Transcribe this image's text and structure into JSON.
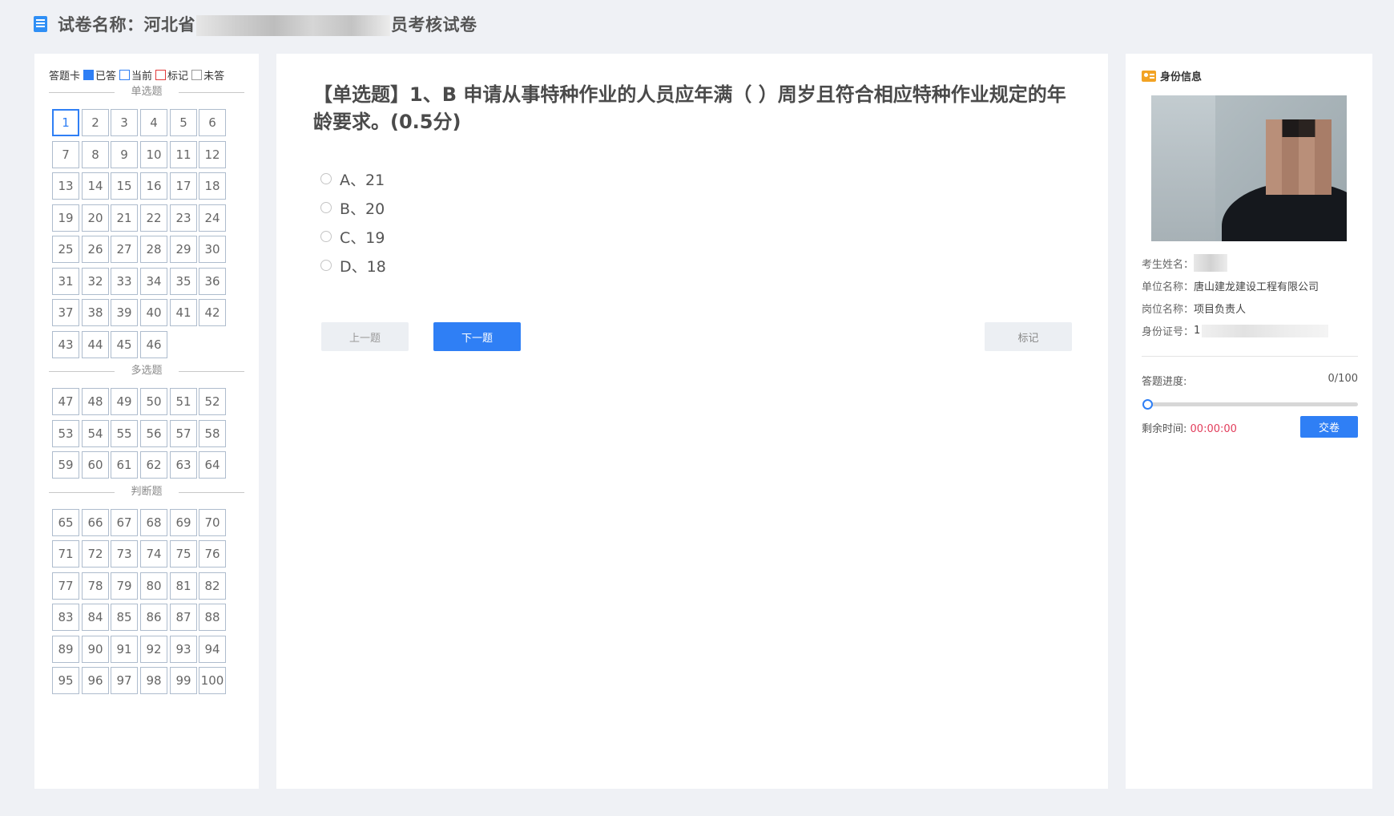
{
  "header": {
    "title_prefix": "试卷名称：河北省",
    "title_suffix": "员考核试卷"
  },
  "answer_card": {
    "legend_title": "答题卡",
    "legend_answered": "已答",
    "legend_current": "当前",
    "legend_marked": "标记",
    "legend_unanswered": "未答",
    "sections": [
      {
        "title": "单选题",
        "start": 1,
        "end": 46
      },
      {
        "title": "多选题",
        "start": 47,
        "end": 64
      },
      {
        "title": "判断题",
        "start": 65,
        "end": 100
      }
    ],
    "current_question": 1
  },
  "question": {
    "text": "【单选题】1、B 申请从事特种作业的人员应年满（ ）周岁且符合相应特种作业规定的年龄要求。(0.5分)",
    "options": [
      "A、21",
      "B、20",
      "C、19",
      "D、18"
    ]
  },
  "buttons": {
    "prev": "上一题",
    "next": "下一题",
    "mark": "标记",
    "submit": "交卷"
  },
  "identity": {
    "title": "身份信息",
    "name_label": "考生姓名：",
    "unit_label": "单位名称：",
    "unit_value": "唐山建龙建设工程有限公司",
    "position_label": "岗位名称：",
    "position_value": "项目负责人",
    "id_label": "身份证号：",
    "id_value_visible": "1"
  },
  "progress": {
    "label": "答题进度:",
    "count": "0/100",
    "fraction": 0
  },
  "timer": {
    "label": "剩余时间:",
    "value": "00:00:00"
  },
  "colors": {
    "accent": "#2f7ff5",
    "marked": "#e03a3a",
    "time": "#e23d5b"
  }
}
